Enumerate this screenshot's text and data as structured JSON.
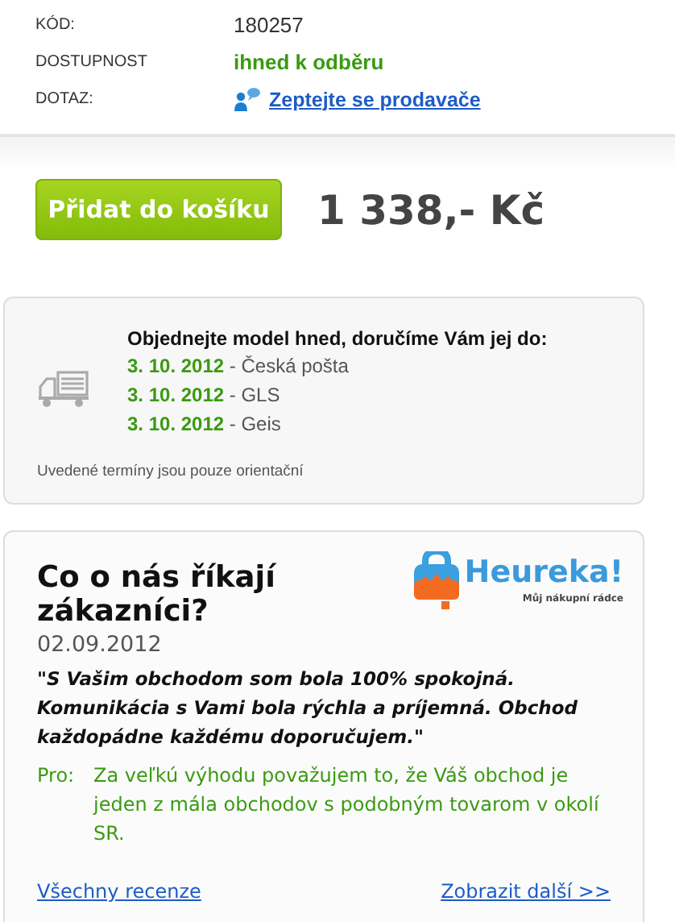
{
  "info_rows": [
    {
      "label": "KÓD:",
      "value": "180257",
      "kind": "plain"
    },
    {
      "label": "DOSTUPNOST",
      "value": "ihned k odběru",
      "kind": "status"
    },
    {
      "label": "DOTAZ:",
      "value": "Zeptejte se prodavače",
      "kind": "link"
    }
  ],
  "cart_button": "Přidat do košíku",
  "price": "1 338,- Kč",
  "delivery": {
    "heading": "Objednejte model hned, doručíme Vám jej do:",
    "options": [
      {
        "date": "3. 10. 2012",
        "carrier": " - Česká pošta"
      },
      {
        "date": "3. 10. 2012",
        "carrier": " - GLS"
      },
      {
        "date": "3. 10. 2012",
        "carrier": " - Geis"
      }
    ],
    "note": "Uvedené termíny jsou pouze orientační"
  },
  "reviews": {
    "title": "Co o nás říkají zákazníci?",
    "logo_name": "Heureka!",
    "logo_tagline": "Můj nákupní rádce",
    "date": "02.09.2012",
    "quote": "\"S Vašim obchodom som bola 100% spokojná. Komunikácia s Vami bola rýchla a príjemná. Obchod každopádne každému doporučujem.\"",
    "pro_label": "Pro:",
    "pro_text": "Za veľkú výhodu považujem to, že Váš obchod je jeden z mála obchodov s podobným tovarom v okolí SR.",
    "links": [
      "Všechny recenze",
      "Zobrazit další >>"
    ]
  }
}
